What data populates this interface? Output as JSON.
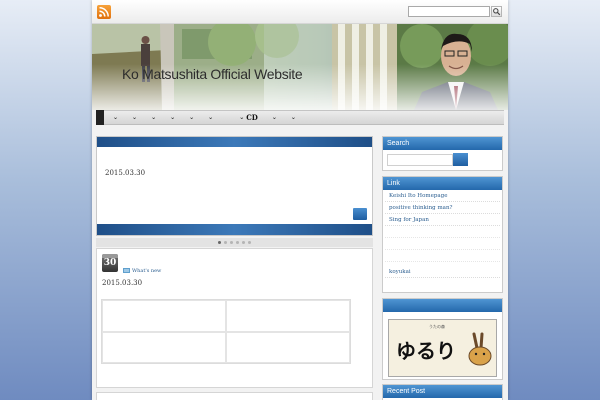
{
  "site": {
    "title": "Ko Matsushita Official Website"
  },
  "nav": {
    "items": [
      {
        "label": ""
      },
      {
        "label": ""
      },
      {
        "label": ""
      },
      {
        "label": ""
      },
      {
        "label": ""
      },
      {
        "label": ""
      },
      {
        "label": "CD"
      },
      {
        "label": ""
      }
    ]
  },
  "slider": {
    "date": "2015.03.30"
  },
  "post": {
    "day": "30",
    "category": "What's new",
    "date": "2015.03.30"
  },
  "sidebar": {
    "search_title": "Search",
    "link_title": "Link",
    "links": [
      "Keishi Ito Homepage",
      "positive thinking man?",
      "Sing for Japan",
      "koyukai"
    ],
    "banner_text": "ゆるり",
    "banner_small": "うたの森",
    "recent_title": "Recent Post"
  },
  "colors": {
    "accent": "#2468ab",
    "slider": "#1f4f88"
  }
}
